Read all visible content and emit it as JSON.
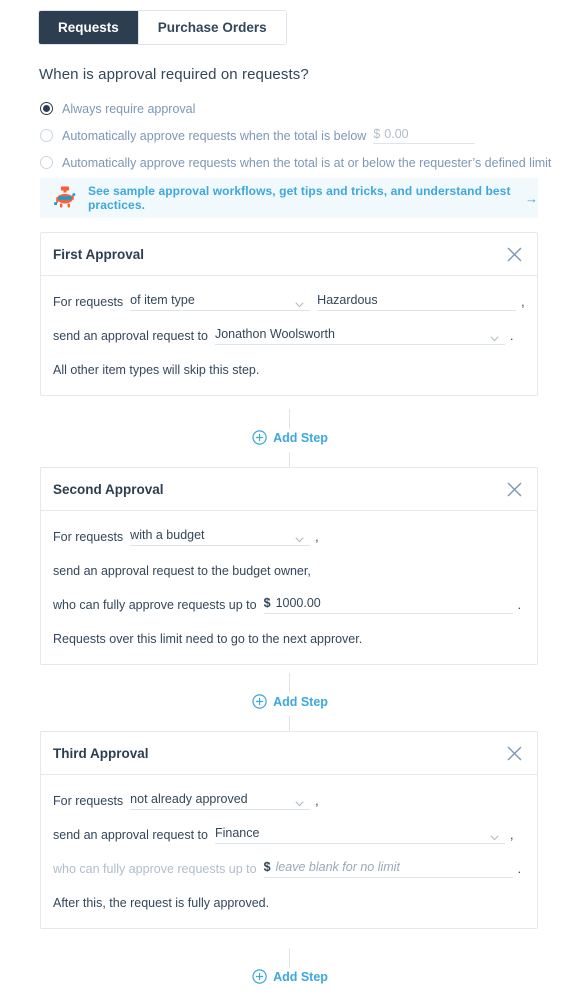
{
  "tabs": [
    {
      "label": "Requests",
      "active": true
    },
    {
      "label": "Purchase Orders",
      "active": false
    }
  ],
  "question": "When is approval required on requests?",
  "radio_options": [
    {
      "label": "Always require approval",
      "checked": true,
      "has_money_field": false
    },
    {
      "label": "Automatically approve requests when the total is below",
      "checked": false,
      "has_money_field": true,
      "currency": "$",
      "value": "0.00"
    },
    {
      "label": "Automatically approve requests when the total is at or below the requester’s defined limit",
      "checked": false,
      "has_money_field": false
    }
  ],
  "banner": {
    "icon": "robot-mascot-icon",
    "text": "See sample approval workflows, get tips and tricks, and understand best practices.",
    "arrow": "→",
    "background": "#f1f9fc",
    "link_color": "#3ca8dd"
  },
  "add_step_label": "Add Step",
  "cards": [
    {
      "title": "First Approval",
      "close_label": "×",
      "row1": {
        "prefix": "For requests",
        "select_value": "of item type",
        "input_value": "Hazardous",
        "suffix": ","
      },
      "row2": {
        "prefix": "send an approval request to",
        "select_value": "Jonathon Woolsworth",
        "suffix": "."
      },
      "footnote": "All other item types will skip this step."
    },
    {
      "title": "Second Approval",
      "close_label": "×",
      "row1": {
        "prefix": "For requests",
        "select_value": "with a budget",
        "suffix": ","
      },
      "row2": {
        "text": "send an approval request to the budget owner,"
      },
      "row3": {
        "prefix": "who can fully approve requests up to",
        "currency": "$",
        "value": "1000.00",
        "suffix": "."
      },
      "footnote": "Requests over this limit need to go to the next approver."
    },
    {
      "title": "Third Approval",
      "close_label": "×",
      "row1": {
        "prefix": "For requests",
        "select_value": "not already approved",
        "suffix": ","
      },
      "row2": {
        "prefix": "send an approval request to",
        "select_value": "Finance",
        "suffix": ","
      },
      "row3": {
        "prefix": "who can fully approve requests up to",
        "currency": "$",
        "placeholder": "leave blank for no limit",
        "suffix": ".",
        "disabled": true
      },
      "footnote": "After this, the request is fully approved."
    }
  ]
}
